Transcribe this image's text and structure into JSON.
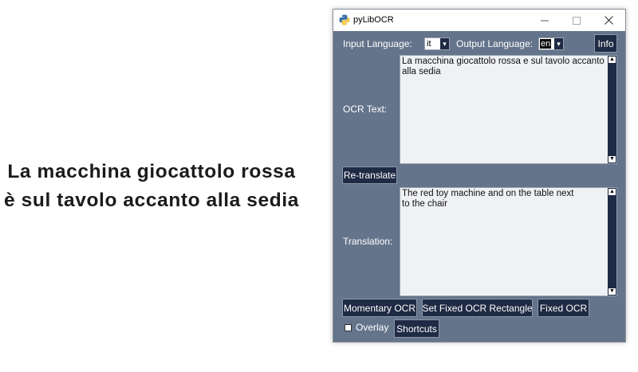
{
  "background_text": "La macchina giocattolo rossa è sul tavolo accanto alla sedia",
  "window": {
    "title": "pyLibOCR",
    "controls": {
      "minimize": "—",
      "maximize": "☐",
      "close": "✕"
    }
  },
  "input_language": {
    "label": "Input Language:",
    "value": "it"
  },
  "output_language": {
    "label": "Output Language:",
    "value": "en"
  },
  "info_button": "Info",
  "ocr_text": {
    "label": "OCR Text:",
    "value": "La macchina giocattolo rossa e sul tavolo accanto alla sedia"
  },
  "retranslate_button": "Re-translate",
  "translation": {
    "label": "Translation:",
    "value": "The red toy machine and on the table next to the chair"
  },
  "buttons": {
    "momentary_ocr": "Momentary OCR",
    "set_fixed_rect": "Set Fixed OCR Rectangle",
    "fixed_ocr": "Fixed OCR",
    "shortcuts": "Shortcuts"
  },
  "overlay": {
    "label": "Overlay",
    "checked": false
  },
  "icons": {
    "dropdown": "▾",
    "scroll_up": "▲",
    "scroll_down": "▼"
  },
  "colors": {
    "window_bg": "#64748b",
    "button_bg": "#1f2a44",
    "textbox_bg": "#eff1f5"
  }
}
